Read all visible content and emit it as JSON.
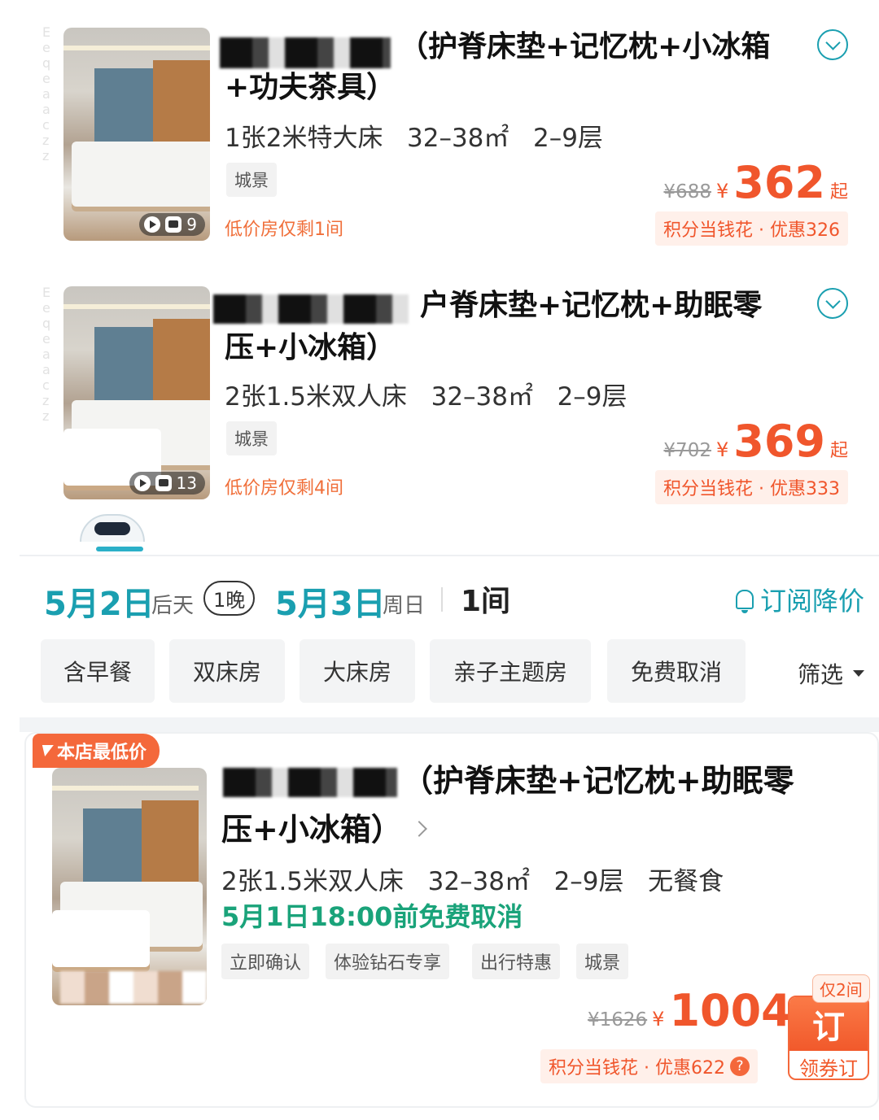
{
  "rooms": [
    {
      "title_line1": "（护脊床垫+记忆枕+小冰箱",
      "title_line2": "+功夫茶具）",
      "bed": "1张2米特大床",
      "area": "32–38㎡",
      "floor": "2–9层",
      "tag": "城景",
      "media_count": "9",
      "low_stock": "低价房仅剩1间",
      "original_price": "¥688",
      "currency": "¥",
      "price": "362",
      "price_suffix": "起",
      "promo": "积分当钱花 · 优惠326"
    },
    {
      "title_line1": "户脊床垫+记忆枕+助眠零",
      "title_line2": "压+小冰箱）",
      "bed": "2张1.5米双人床",
      "area": "32–38㎡",
      "floor": "2–9层",
      "tag": "城景",
      "media_count": "13",
      "low_stock": "低价房仅剩4间",
      "original_price": "¥702",
      "currency": "¥",
      "price": "369",
      "price_suffix": "起",
      "promo": "积分当钱花 · 优惠333"
    }
  ],
  "date_bar": {
    "checkin": "5月2日",
    "checkin_day": "后天",
    "nights": "1晚",
    "checkout": "5月3日",
    "checkout_day": "周日",
    "rooms": "1间",
    "subscribe": "订阅降价"
  },
  "filters": {
    "chips": [
      "含早餐",
      "双床房",
      "大床房",
      "亲子主题房",
      "免费取消"
    ],
    "filter_label": "筛选"
  },
  "featured": {
    "badge": "本店最低价",
    "title_line1": "（护脊床垫+记忆枕+助眠零",
    "title_line2": "压+小冰箱）",
    "bed": "2张1.5米双人床",
    "area": "32–38㎡",
    "floor": "2–9层",
    "meal": "无餐食",
    "free_cancel": "5月1日18:00前免费取消",
    "tags": [
      "立即确认",
      "体验钻石专享",
      "出行特惠",
      "城景"
    ],
    "original_price": "¥1626",
    "currency": "¥",
    "price": "1004",
    "promo": "积分当钱花 · 优惠622",
    "help_icon_char": "?",
    "only_left": "仅2间",
    "book_label": "订",
    "book_sub": "领券订"
  },
  "watermark": "Eeqeaaczz",
  "colors": {
    "accent_teal": "#1a9fb0",
    "price_orange": "#f0562c",
    "cancel_green": "#1aa37a"
  },
  "icons": [
    "play-icon",
    "photo-icon",
    "expand-chevron-icon",
    "bell-icon",
    "caret-down-icon",
    "bolt-icon",
    "chevron-right-icon",
    "help-icon",
    "robot-mascot-icon"
  ]
}
